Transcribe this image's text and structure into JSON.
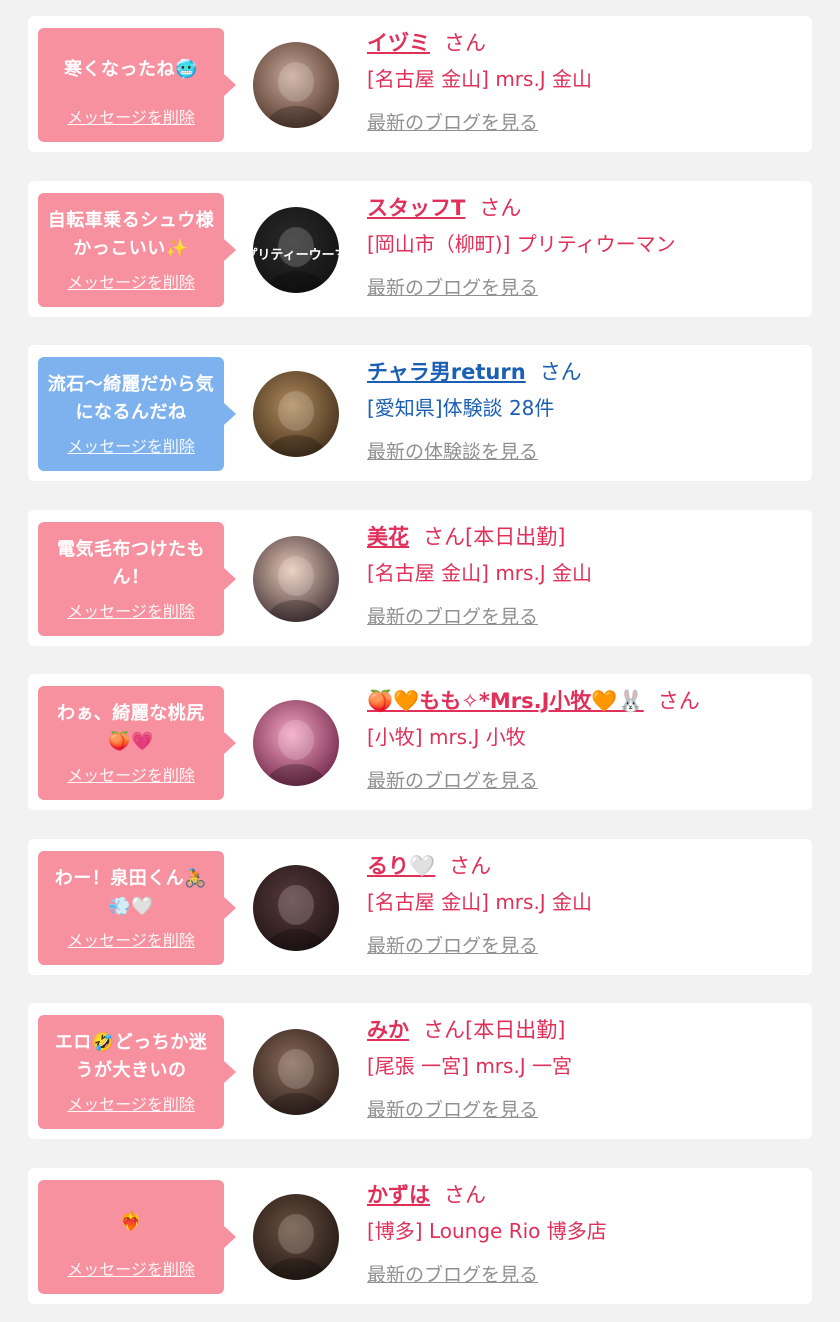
{
  "delete_label": "メッセージを削除",
  "san": "さん",
  "colors": {
    "pink_bubble": "#f7909f",
    "blue_bubble": "#7eb2ef",
    "name_pink": "#e0305a",
    "name_blue": "#1a5fb4",
    "link_gray": "#909090"
  },
  "items": [
    {
      "message": "寒くなったね🥶",
      "name": "イヅミ",
      "status": "",
      "shop": "[名古屋 金山] mrs.J 金山",
      "link": "最新のブログを見る",
      "bubble": "pink",
      "avatar_icon": "woman-hair-clip-avatar",
      "avatar": {
        "bg1": "#c9a99a",
        "bg2": "#4a3024"
      }
    },
    {
      "message": "自転車乗るシュウ様かっこいい✨",
      "name": "スタッフT",
      "status": "",
      "shop": "[岡山市（柳町)] プリティウーマン",
      "link": "最新のブログを見る",
      "bubble": "pink",
      "avatar_icon": "pretty-woman-logo-avatar",
      "avatar": {
        "bg1": "#2a2a2a",
        "bg2": "#111111"
      },
      "avatar_text": "プリティーウーマ"
    },
    {
      "message": "流石〜綺麗だから気になるんだね",
      "name": "チャラ男return",
      "status": "",
      "shop": "[愛知県]体験談 28件",
      "link": "最新の体験談を見る",
      "bubble": "blue",
      "avatar_icon": "food-table-avatar",
      "avatar": {
        "bg1": "#b08a5c",
        "bg2": "#3d2a18"
      }
    },
    {
      "message": "電気毛布つけたもん！",
      "name": "美花",
      "status": "[本日出勤]",
      "shop": "[名古屋 金山] mrs.J 金山",
      "link": "最新のブログを見る",
      "bubble": "pink",
      "avatar_icon": "woman-portrait-avatar",
      "avatar": {
        "bg1": "#e8c9b6",
        "bg2": "#3a2a30"
      }
    },
    {
      "message": "わぁ、綺麗な桃尻🍑💗",
      "name": "🍑🧡もも✧*Mrs.J小牧🧡🐰",
      "status": "",
      "shop": "[小牧] mrs.J 小牧",
      "link": "最新のブログを見る",
      "bubble": "pink",
      "avatar_icon": "pink-light-avatar",
      "avatar": {
        "bg1": "#f4a6c2",
        "bg2": "#6a1f45"
      }
    },
    {
      "message": "わー！泉田くん🚴💨🤍",
      "name": "るり🤍",
      "status": "",
      "shop": "[名古屋 金山] mrs.J 金山",
      "link": "最新のブログを見る",
      "bubble": "pink",
      "avatar_icon": "heart-face-avatar",
      "avatar": {
        "bg1": "#5a3a3a",
        "bg2": "#1c1214"
      }
    },
    {
      "message": "エロ🤣どっちか迷うが大きいの",
      "name": "みか",
      "status": "[本日出勤]",
      "shop": "[尾張 一宮] mrs.J 一宮",
      "link": "最新のブログを見る",
      "bubble": "pink",
      "avatar_icon": "cat-sticker-avatar",
      "avatar": {
        "bg1": "#8a6a5a",
        "bg2": "#2a1c18"
      }
    },
    {
      "message": "❤️‍🔥",
      "name": "かずは",
      "status": "",
      "shop": "[博多] Lounge Rio 博多店",
      "link": "最新のブログを見る",
      "bubble": "pink",
      "avatar_icon": "braided-hair-avatar",
      "avatar": {
        "bg1": "#6a5040",
        "bg2": "#1e1612"
      }
    }
  ]
}
